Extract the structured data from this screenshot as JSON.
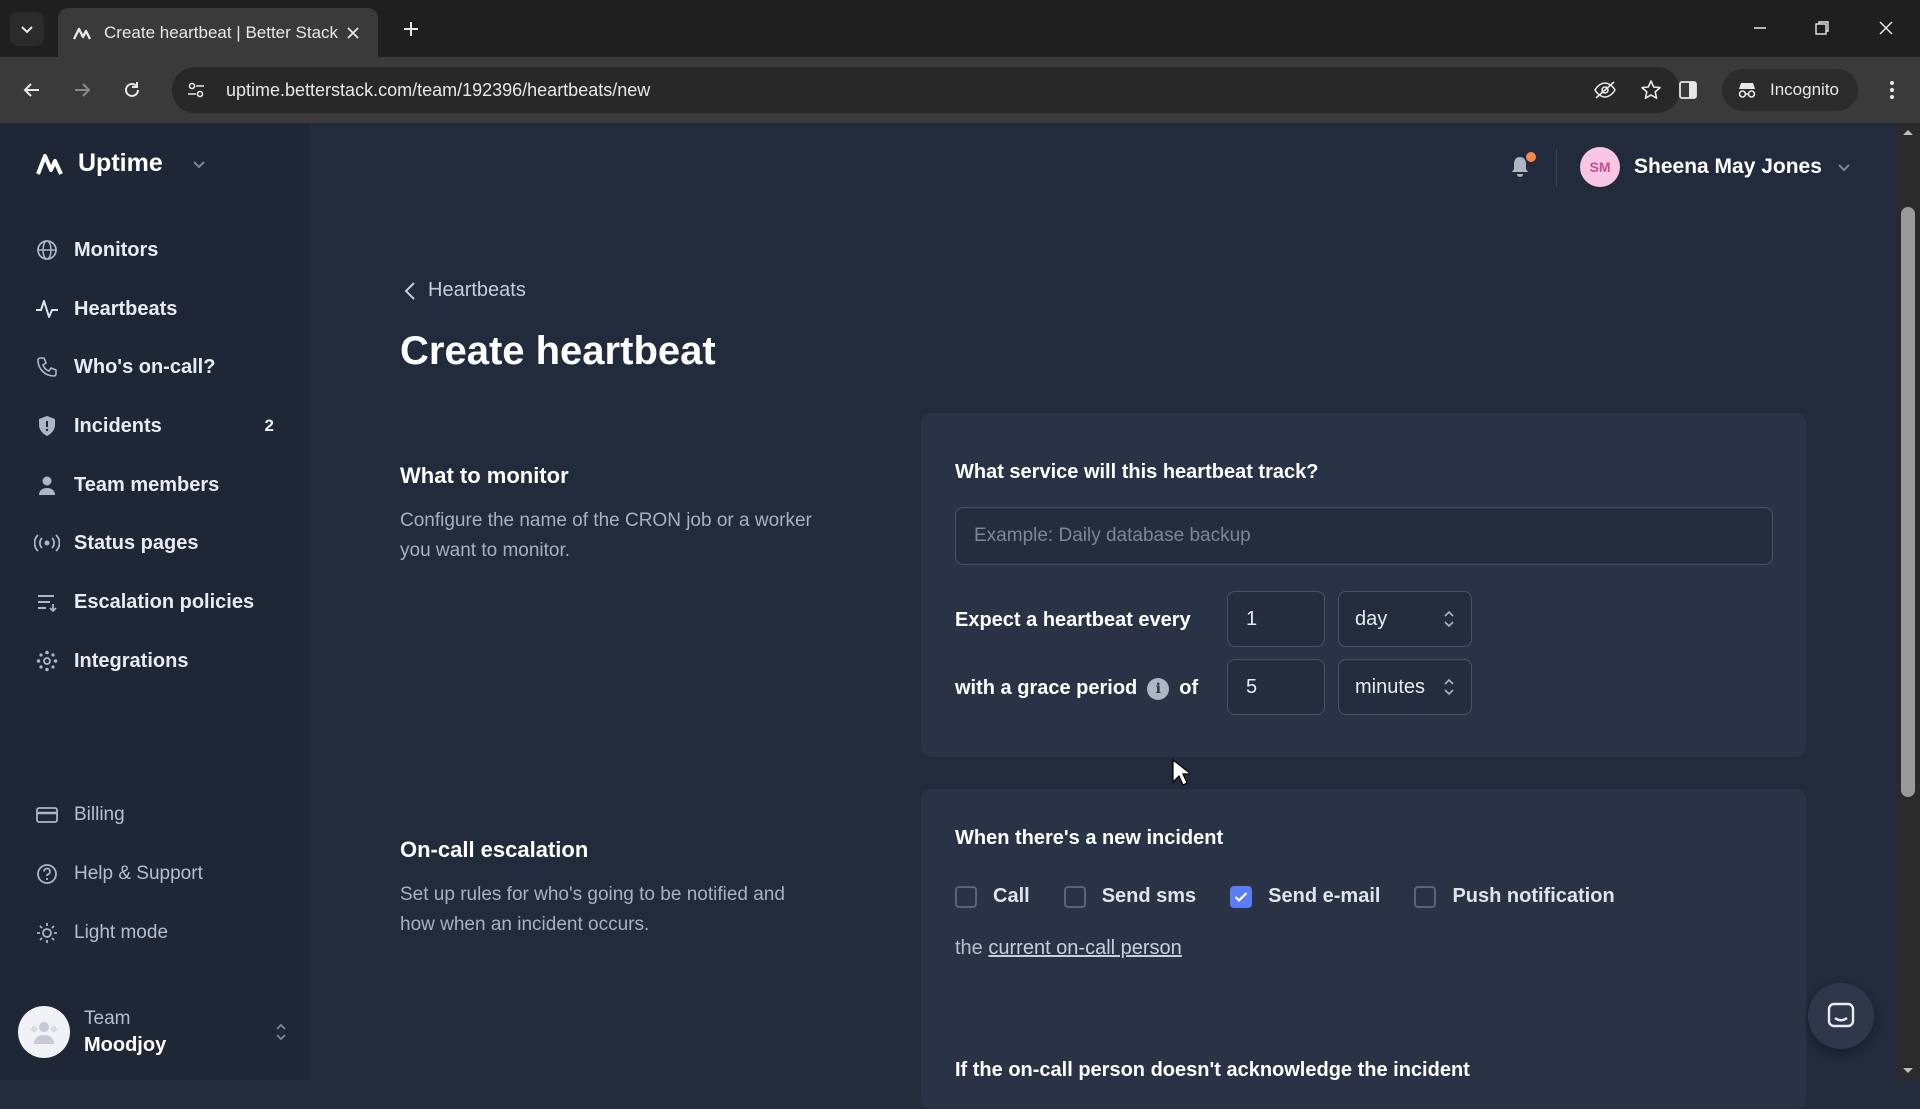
{
  "browser": {
    "tab_title": "Create heartbeat | Better Stack",
    "url": "uptime.betterstack.com/team/192396/heartbeats/new",
    "incognito_label": "Incognito"
  },
  "app": {
    "product_name": "Uptime",
    "nav": [
      {
        "label": "Monitors",
        "icon": "globe-icon"
      },
      {
        "label": "Heartbeats",
        "icon": "pulse-icon"
      },
      {
        "label": "Who's on-call?",
        "icon": "phone-icon"
      },
      {
        "label": "Incidents",
        "icon": "shield-icon",
        "badge": "2"
      },
      {
        "label": "Team members",
        "icon": "person-icon"
      },
      {
        "label": "Status pages",
        "icon": "broadcast-icon"
      },
      {
        "label": "Escalation policies",
        "icon": "list-icon"
      },
      {
        "label": "Integrations",
        "icon": "integrations-icon"
      }
    ],
    "bottom_nav": [
      {
        "label": "Billing",
        "icon": "card-icon"
      },
      {
        "label": "Help & Support",
        "icon": "help-icon"
      },
      {
        "label": "Light mode",
        "icon": "sun-icon"
      }
    ],
    "team": {
      "label": "Team",
      "name": "Moodjoy"
    },
    "user": {
      "initials": "SM",
      "name": "Sheena May Jones"
    }
  },
  "page": {
    "back_label": "Heartbeats",
    "title": "Create heartbeat",
    "monitor_section": {
      "title": "What to monitor",
      "description": "Configure the name of the CRON job or a worker you want to monitor."
    },
    "monitor_card": {
      "question": "What service will this heartbeat track?",
      "placeholder": "Example: Daily database backup",
      "expect_label": "Expect a heartbeat every",
      "expect_value": "1",
      "expect_unit": "day",
      "grace_label": "with a grace period",
      "grace_of": "of",
      "grace_value": "5",
      "grace_unit": "minutes"
    },
    "escalation_section": {
      "title": "On-call escalation",
      "description": "Set up rules for who's going to be notified and how when an incident occurs."
    },
    "escalation_card": {
      "title": "When there's a new incident",
      "options": [
        {
          "label": "Call",
          "checked": false
        },
        {
          "label": "Send sms",
          "checked": false
        },
        {
          "label": "Send e-mail",
          "checked": true
        },
        {
          "label": "Push notification",
          "checked": false
        }
      ],
      "target_prefix": "the",
      "target_link": "current on-call person",
      "next_rule": "If the on-call person doesn't acknowledge the incident"
    }
  },
  "colors": {
    "accent": "#5b7cf5",
    "notification_dot": "#f7894a",
    "background": "#222b3b"
  }
}
